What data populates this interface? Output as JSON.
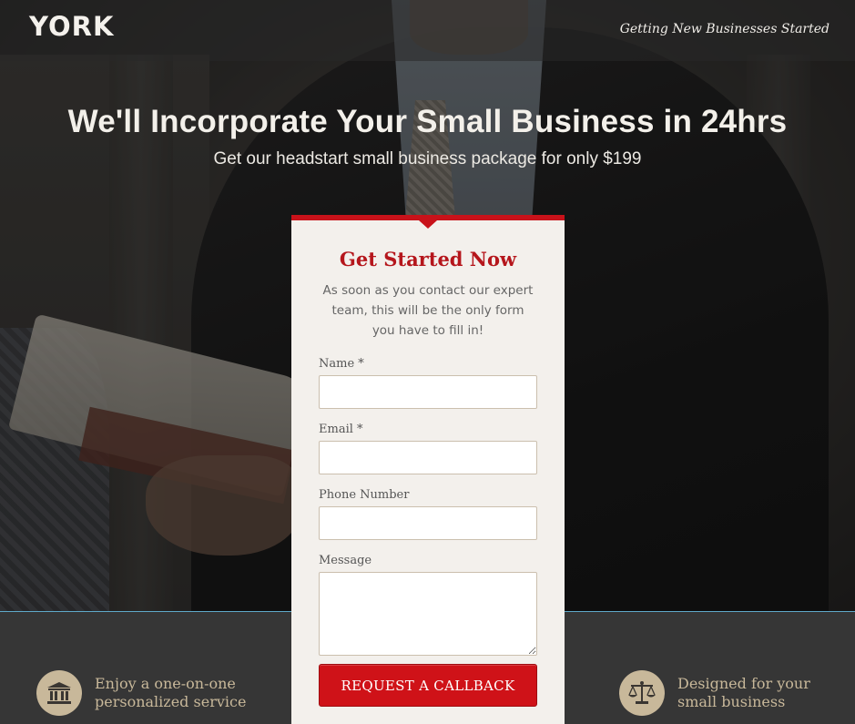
{
  "header": {
    "logo": "YORK",
    "tagline": "Getting New Businesses Started"
  },
  "hero": {
    "headline": "We'll Incorporate Your Small Business in 24hrs",
    "subheadline": "Get our headstart small business package for only $199"
  },
  "form": {
    "title": "Get Started Now",
    "description": "As soon as you contact our expert team, this will be the only form you have to fill in!",
    "fields": {
      "name": {
        "label": "Name *",
        "value": "",
        "placeholder": ""
      },
      "email": {
        "label": "Email *",
        "value": "",
        "placeholder": ""
      },
      "phone": {
        "label": "Phone Number",
        "value": "",
        "placeholder": ""
      },
      "message": {
        "label": "Message",
        "value": "",
        "placeholder": ""
      }
    },
    "submit_label": "REQUEST A CALLBACK"
  },
  "features": [
    {
      "icon": "bank-icon",
      "text_line1": "Enjoy a one-on-one",
      "text_line2": "personalized service"
    },
    {
      "icon": "scales-icon",
      "text_line1": "Designed for your",
      "text_line2": "small business"
    }
  ],
  "colors": {
    "accent_red": "#c8121a",
    "feature_tan": "#c8b89a",
    "footer_bg": "#363636",
    "card_bg": "#f3f0ec"
  }
}
